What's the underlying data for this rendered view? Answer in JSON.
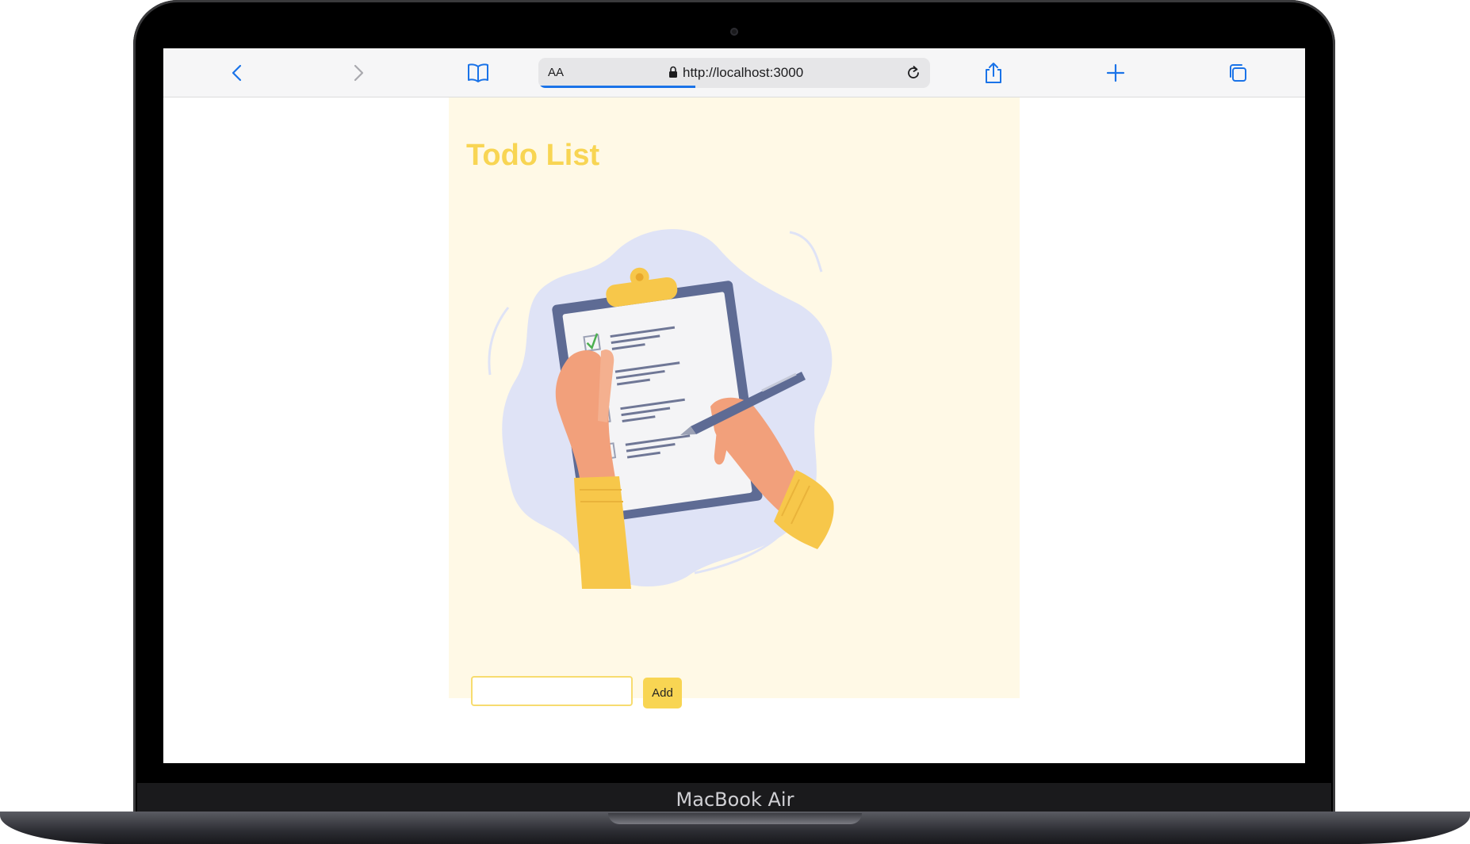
{
  "browser": {
    "text_size_label": "AA",
    "url": "http://localhost:3000"
  },
  "app": {
    "title": "Todo List",
    "input_value": "",
    "add_label": "Add"
  },
  "device": {
    "brand_label": "MacBook Air"
  },
  "colors": {
    "accent": "#f8d553",
    "app_background": "#fff9e6",
    "browser_blue": "#1a73e8"
  }
}
